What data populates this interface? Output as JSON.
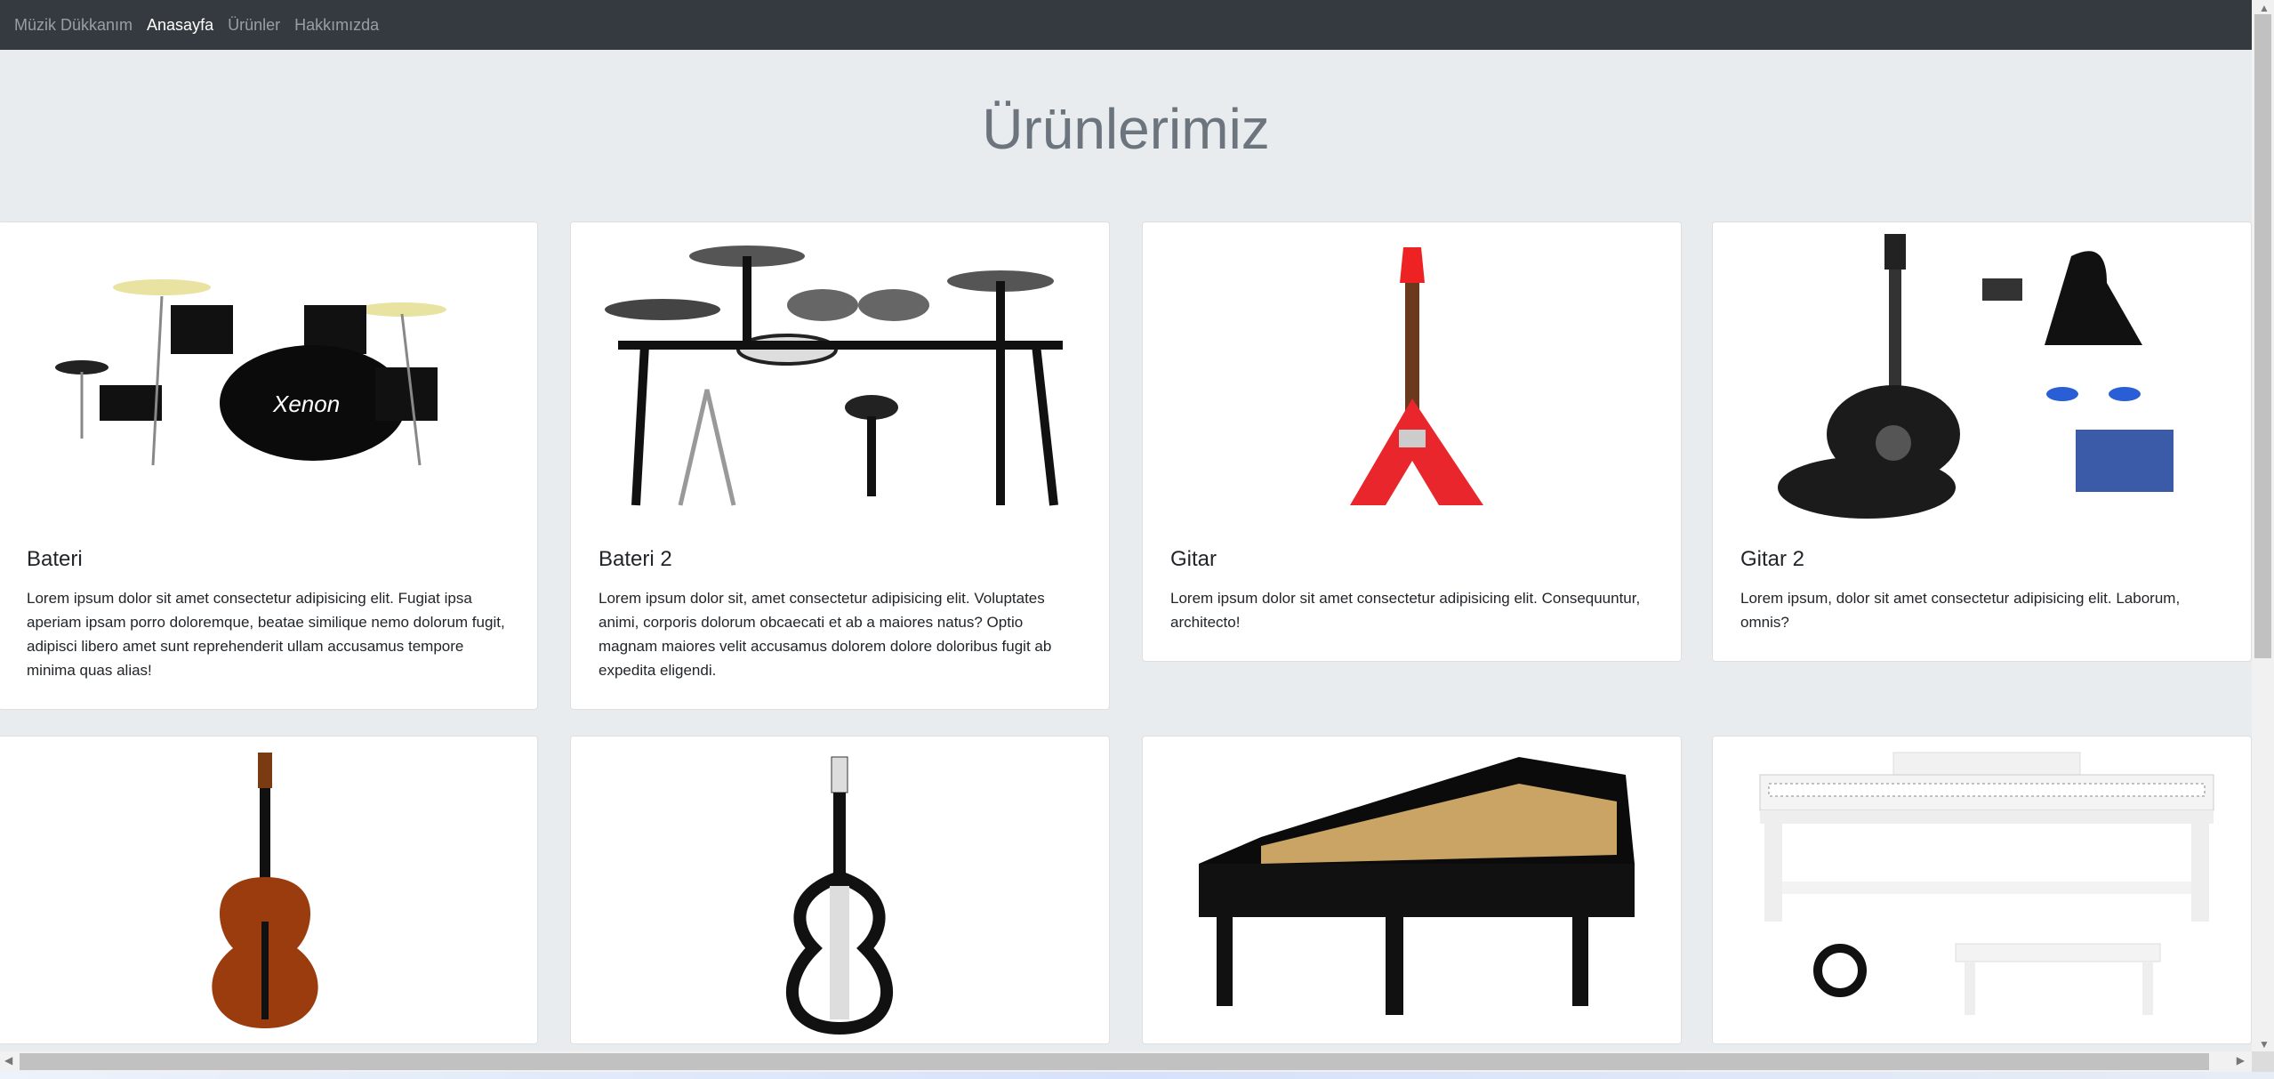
{
  "navbar": {
    "brand": "Müzik Dükkanım",
    "links": [
      {
        "label": "Anasayfa",
        "active": true
      },
      {
        "label": "Ürünler",
        "active": false
      },
      {
        "label": "Hakkımızda",
        "active": false
      }
    ]
  },
  "page_title": "Ürünlerimiz",
  "products": [
    {
      "name": "Bateri",
      "description": "Lorem ipsum dolor sit amet consectetur adipisicing elit. Fugiat ipsa aperiam ipsam porro doloremque, beatae similique nemo dolorum fugit, adipisci libero amet sunt reprehenderit ullam accusamus tempore minima quas alias!",
      "image": "drum-kit"
    },
    {
      "name": "Bateri 2",
      "description": "Lorem ipsum dolor sit, amet consectetur adipisicing elit. Voluptates animi, corporis dolorum obcaecati et ab a maiores natus? Optio magnam maiores velit accusamus dolorem dolore doloribus fugit ab expedita eligendi.",
      "image": "electronic-drum-kit"
    },
    {
      "name": "Gitar",
      "description": "Lorem ipsum dolor sit amet consectetur adipisicing elit. Consequuntur, architecto!",
      "image": "electric-guitar"
    },
    {
      "name": "Gitar 2",
      "description": "Lorem ipsum, dolor sit amet consectetur adipisicing elit. Laborum, omnis?",
      "image": "acoustic-guitar-set"
    },
    {
      "image": "violin"
    },
    {
      "image": "electric-violin"
    },
    {
      "image": "grand-piano"
    },
    {
      "image": "digital-piano"
    }
  ]
}
